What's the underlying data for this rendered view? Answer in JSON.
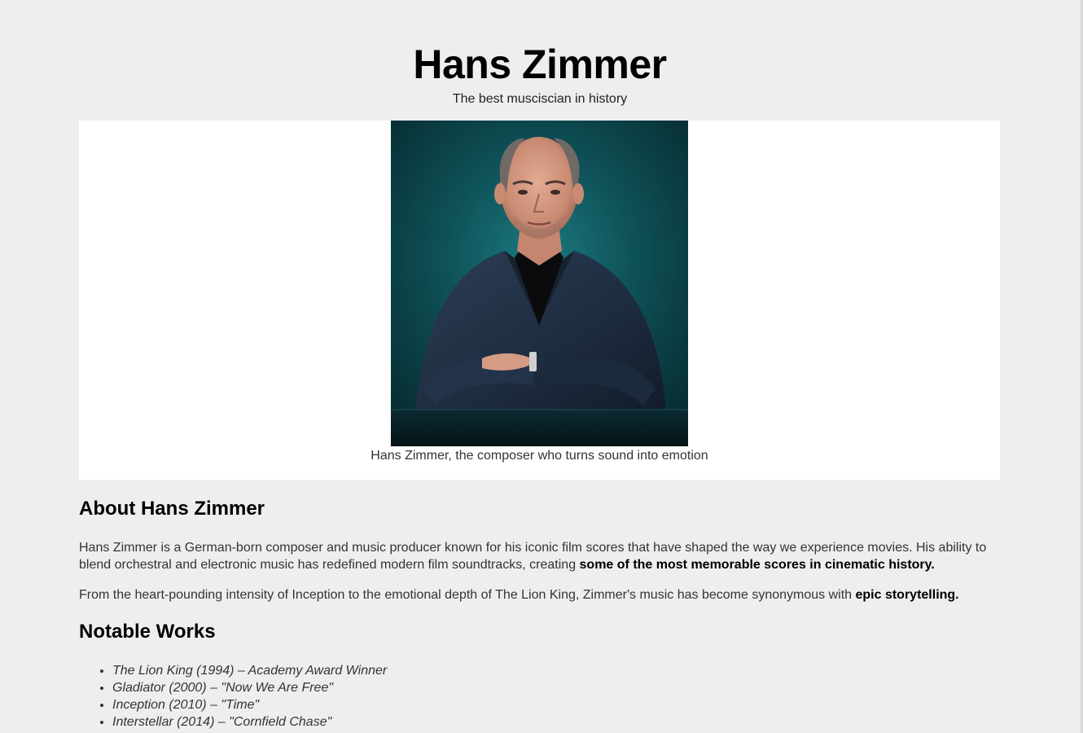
{
  "header": {
    "title": "Hans Zimmer",
    "tagline": "The best musciscian in history"
  },
  "image": {
    "alt": "Hans Zimmer portrait",
    "caption": "Hans Zimmer, the composer who turns sound into emotion"
  },
  "about": {
    "heading": "About Hans Zimmer",
    "p1_text": "Hans Zimmer is a German-born composer and music producer known for his iconic film scores that have shaped the way we experience movies. His ability to blend orchestral and electronic music has redefined modern film soundtracks, creating ",
    "p1_bold": "some of the most memorable scores in cinematic history.",
    "p2_text": "From the heart-pounding intensity of Inception to the emotional depth of The Lion King, Zimmer's music has become synonymous with ",
    "p2_bold": "epic storytelling."
  },
  "works": {
    "heading": "Notable Works",
    "items": [
      "The Lion King (1994) – Academy Award Winner",
      "Gladiator (2000) – \"Now We Are Free\"",
      "Inception (2010) – \"Time\"",
      "Interstellar (2014) – \"Cornfield Chase\""
    ]
  },
  "colors": {
    "page_background": "#eeeeee",
    "image_panel_background": "#ffffff",
    "portrait_backdrop": "#0d4f55"
  }
}
